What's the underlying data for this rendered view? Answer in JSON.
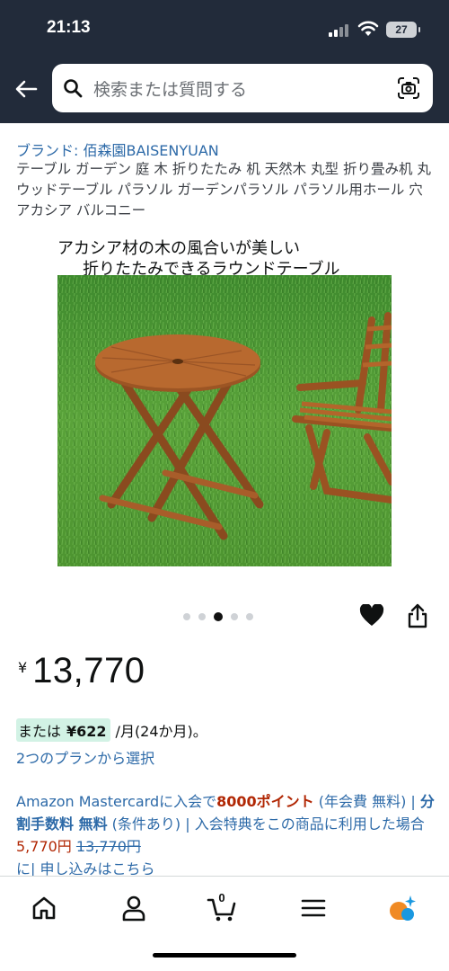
{
  "status_bar": {
    "time": "21:13",
    "battery": "27"
  },
  "search": {
    "placeholder": "検索または質問する"
  },
  "product": {
    "brand": "ブランド: 佰森園BAISENYUAN",
    "title": "テーブル ガーデン 庭 木 折りたたみ 机 天然木 丸型 折り畳み机 丸 ウッドテーブル パラソル ガーデンパラソル パラソル用ホール 穴 アカシア バルコニー",
    "image_caption_line1": "アカシア材の木の風合いが美しい",
    "image_caption_line2": "折りたたみできるラウンドテーブル",
    "carousel": {
      "count": 5,
      "active_index": 2
    },
    "price_symbol": "¥",
    "price": "13,770",
    "installment_prefix": "または",
    "installment_amount": "¥622",
    "installment_suffix": "/月(24か月)。",
    "plans_link": "2つのプランから選択"
  },
  "promo": {
    "part1": "Amazon Mastercardに入会で",
    "points": "8000ポイント",
    "part2": " (年会費 無料) | ",
    "bunkatsu": "分割手数料 無料",
    "part3": " (条件あり) | 入会特典をこの商品に利用した場合",
    "discounted": "5,770円",
    "original": "13,770円",
    "part4": "に| 申し込みはこちら"
  },
  "bottom_nav": {
    "cart_count": "0",
    "items": [
      "home-icon",
      "account-icon",
      "cart-icon",
      "menu-icon",
      "rufus-ai-icon"
    ]
  },
  "colors": {
    "header_bg": "#222b3a",
    "link": "#2d6aa8",
    "price_red": "#b12704",
    "installment_bg": "#d2f2e5"
  }
}
